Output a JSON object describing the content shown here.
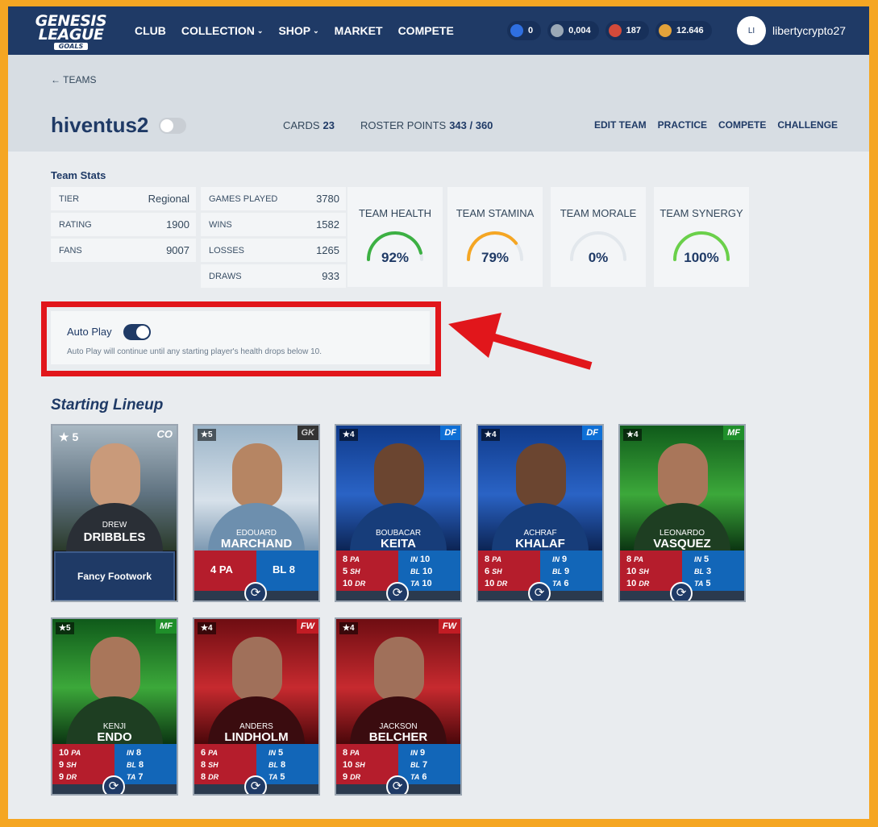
{
  "nav": {
    "logo_line1": "GENESIS",
    "logo_line2": "LEAGUE",
    "logo_line3": "GOALS",
    "links": [
      "CLUB",
      "COLLECTION",
      "SHOP",
      "MARKET",
      "COMPETE"
    ],
    "currencies": [
      {
        "value": "0",
        "icon": "star-token-icon",
        "color": "#2f6fe0"
      },
      {
        "value": "0,004",
        "icon": "globe-token-icon",
        "color": "#9aa8b6"
      },
      {
        "value": "187",
        "icon": "ball-token-icon",
        "color": "#d24a3a"
      },
      {
        "value": "12.646",
        "icon": "coin-token-icon",
        "color": "#e2a23a"
      }
    ],
    "avatar_initials": "LI",
    "username": "libertycrypto27"
  },
  "header": {
    "back_label": "← TEAMS",
    "team_name": "hiventus2",
    "cards_label": "CARDS",
    "cards_value": "23",
    "roster_label": "ROSTER POINTS",
    "roster_value": "343 / 360",
    "actions": [
      "EDIT TEAM",
      "PRACTICE",
      "COMPETE",
      "CHALLENGE"
    ]
  },
  "team_stats": {
    "title": "Team Stats",
    "col1": [
      {
        "k": "TIER",
        "v": "Regional"
      },
      {
        "k": "RATING",
        "v": "1900"
      },
      {
        "k": "FANS",
        "v": "9007"
      }
    ],
    "col2": [
      {
        "k": "GAMES PLAYED",
        "v": "3780"
      },
      {
        "k": "WINS",
        "v": "1582"
      },
      {
        "k": "LOSSES",
        "v": "1265"
      },
      {
        "k": "DRAWS",
        "v": "933"
      }
    ],
    "gauges": [
      {
        "label": "TEAM HEALTH",
        "value": "92%",
        "fraction": 0.92,
        "color": "#3cb043"
      },
      {
        "label": "TEAM STAMINA",
        "value": "79%",
        "fraction": 0.79,
        "color": "#f5a623"
      },
      {
        "label": "TEAM MORALE",
        "value": "0%",
        "fraction": 0.0,
        "color": "#cfd6dc"
      },
      {
        "label": "TEAM SYNERGY",
        "value": "100%",
        "fraction": 1.0,
        "color": "#6ad04a"
      }
    ]
  },
  "autoplay": {
    "label": "Auto Play",
    "enabled": true,
    "description": "Auto Play will continue until any starting player's health drops below 10."
  },
  "lineup": {
    "title": "Starting Lineup",
    "coach": {
      "stars": "★ 5",
      "pos": "CO",
      "first": "DREW",
      "last": "DRIBBLES",
      "trait": "Fancy Footwork"
    },
    "gk": {
      "stars": "★5",
      "pos": "GK",
      "first": "EDOUARD",
      "last": "MARCHAND",
      "left": "4 PA",
      "right": "BL 8"
    },
    "players": [
      {
        "stars": "★4",
        "pos": "DF",
        "first": "BOUBACAR",
        "last": "KEITA",
        "theme": "blue",
        "l": [
          [
            "8",
            "PA"
          ],
          [
            "5",
            "SH"
          ],
          [
            "10",
            "DR"
          ]
        ],
        "r": [
          [
            "IN",
            "10"
          ],
          [
            "BL",
            "10"
          ],
          [
            "TA",
            "10"
          ]
        ]
      },
      {
        "stars": "★4",
        "pos": "DF",
        "first": "ACHRAF",
        "last": "KHALAF",
        "theme": "blue",
        "l": [
          [
            "8",
            "PA"
          ],
          [
            "6",
            "SH"
          ],
          [
            "10",
            "DR"
          ]
        ],
        "r": [
          [
            "IN",
            "9"
          ],
          [
            "BL",
            "9"
          ],
          [
            "TA",
            "6"
          ]
        ]
      },
      {
        "stars": "★4",
        "pos": "MF",
        "first": "LEONARDO",
        "last": "VASQUEZ",
        "theme": "green",
        "l": [
          [
            "8",
            "PA"
          ],
          [
            "10",
            "SH"
          ],
          [
            "10",
            "DR"
          ]
        ],
        "r": [
          [
            "IN",
            "5"
          ],
          [
            "BL",
            "3"
          ],
          [
            "TA",
            "5"
          ]
        ]
      },
      {
        "stars": "★5",
        "pos": "MF",
        "first": "KENJI",
        "last": "ENDO",
        "theme": "green",
        "l": [
          [
            "10",
            "PA"
          ],
          [
            "9",
            "SH"
          ],
          [
            "9",
            "DR"
          ]
        ],
        "r": [
          [
            "IN",
            "8"
          ],
          [
            "BL",
            "8"
          ],
          [
            "TA",
            "7"
          ]
        ]
      },
      {
        "stars": "★4",
        "pos": "FW",
        "first": "ANDERS",
        "last": "LINDHOLM",
        "theme": "red",
        "l": [
          [
            "6",
            "PA"
          ],
          [
            "8",
            "SH"
          ],
          [
            "8",
            "DR"
          ]
        ],
        "r": [
          [
            "IN",
            "5"
          ],
          [
            "BL",
            "8"
          ],
          [
            "TA",
            "5"
          ]
        ]
      },
      {
        "stars": "★4",
        "pos": "FW",
        "first": "JACKSON",
        "last": "BELCHER",
        "theme": "red",
        "l": [
          [
            "8",
            "PA"
          ],
          [
            "10",
            "SH"
          ],
          [
            "9",
            "DR"
          ]
        ],
        "r": [
          [
            "IN",
            "9"
          ],
          [
            "BL",
            "7"
          ],
          [
            "TA",
            "6"
          ]
        ]
      }
    ]
  }
}
